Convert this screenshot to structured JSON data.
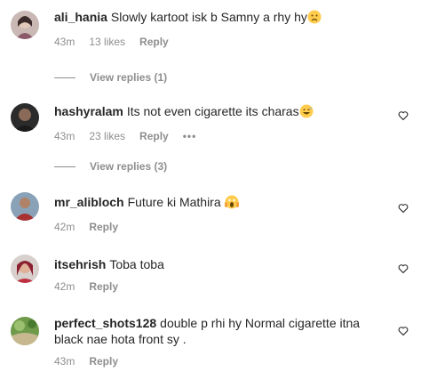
{
  "comments": [
    {
      "username": "ali_hania",
      "text": "Slowly kartoot isk b Samny a rhy hy",
      "emoji": "sad-face",
      "time": "43m",
      "likes": "13 likes",
      "reply": "Reply",
      "view_replies": "View replies (1)"
    },
    {
      "username": "hashyralam",
      "text": "Its not even cigarette its charas",
      "emoji": "grinning-sweat-face",
      "time": "43m",
      "likes": "23 likes",
      "reply": "Reply",
      "more": "•••",
      "view_replies": "View replies (3)"
    },
    {
      "username": "mr_alibloch",
      "text": "Future ki Mathira",
      "emoji": "screaming-face",
      "time": "42m",
      "reply": "Reply"
    },
    {
      "username": "itsehrish",
      "text": "Toba toba",
      "time": "42m",
      "reply": "Reply"
    },
    {
      "username": "perfect_shots128",
      "text": "double p rhi hy Normal cigarette itna black nae hota front sy .",
      "time": "43m",
      "reply": "Reply"
    }
  ],
  "icons": {
    "like": "heart-outline-icon"
  }
}
